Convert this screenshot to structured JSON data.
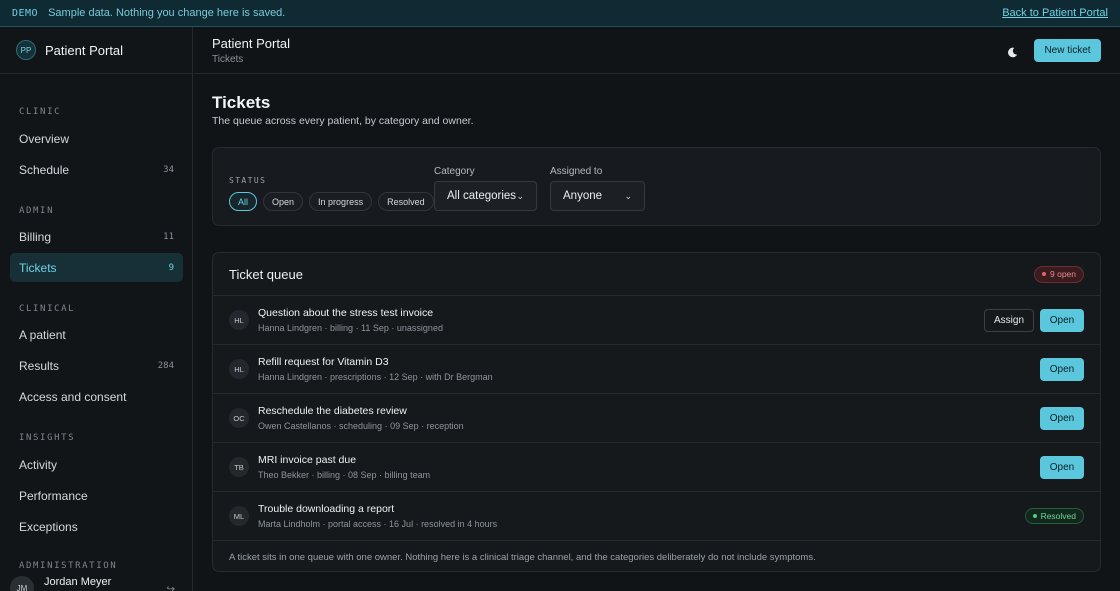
{
  "banner": {
    "tag": "DEMO",
    "message": "Sample data. Nothing you change here is saved.",
    "back_link": "Back to Patient Portal"
  },
  "brand": {
    "initials": "PP",
    "name": "Patient Portal"
  },
  "sidebar": {
    "sections": [
      {
        "label": "CLINIC",
        "items": [
          {
            "label": "Overview",
            "count": ""
          },
          {
            "label": "Schedule",
            "count": "34"
          }
        ]
      },
      {
        "label": "ADMIN",
        "items": [
          {
            "label": "Billing",
            "count": "11"
          },
          {
            "label": "Tickets",
            "count": "9",
            "active": true
          }
        ]
      },
      {
        "label": "CLINICAL",
        "items": [
          {
            "label": "A patient",
            "count": ""
          },
          {
            "label": "Results",
            "count": "284"
          },
          {
            "label": "Access and consent",
            "count": ""
          }
        ]
      },
      {
        "label": "INSIGHTS",
        "items": [
          {
            "label": "Activity",
            "count": ""
          },
          {
            "label": "Performance",
            "count": ""
          },
          {
            "label": "Exceptions",
            "count": ""
          }
        ]
      },
      {
        "label": "ADMINISTRATION",
        "items": []
      }
    ],
    "user": {
      "initials": "JM",
      "name": "Jordan Meyer"
    }
  },
  "header": {
    "title": "Patient Portal",
    "breadcrumb": "Tickets",
    "theme_icon": "moon-icon",
    "new_ticket_label": "New ticket"
  },
  "page": {
    "title": "Tickets",
    "subtitle": "The queue across every patient, by category and owner."
  },
  "filters": {
    "status_label": "STATUS",
    "status_options": [
      "All",
      "Open",
      "In progress",
      "Resolved"
    ],
    "status_selected": "All",
    "category_label": "Category",
    "category_value": "All categories",
    "assigned_label": "Assigned to",
    "assigned_value": "Anyone"
  },
  "queue": {
    "title": "Ticket queue",
    "open_badge": "9 open",
    "rows": [
      {
        "initials": "HL",
        "title": "Question about the stress test invoice",
        "meta": "Hanna Lindgren · billing · 11 Sep · unassigned",
        "assign": "Assign",
        "action": "Open",
        "status": ""
      },
      {
        "initials": "HL",
        "title": "Refill request for Vitamin D3",
        "meta": "Hanna Lindgren · prescriptions · 12 Sep · with Dr Bergman",
        "assign": "",
        "action": "Open",
        "status": ""
      },
      {
        "initials": "OC",
        "title": "Reschedule the diabetes review",
        "meta": "Owen Castellanos · scheduling · 09 Sep · reception",
        "assign": "",
        "action": "Open",
        "status": ""
      },
      {
        "initials": "TB",
        "title": "MRI invoice past due",
        "meta": "Theo Bekker · billing · 08 Sep · billing team",
        "assign": "",
        "action": "Open",
        "status": ""
      },
      {
        "initials": "ML",
        "title": "Trouble downloading a report",
        "meta": "Marta Lindholm · portal access · 16 Jul · resolved in 4 hours",
        "assign": "",
        "action": "",
        "status": "Resolved"
      }
    ],
    "footer": "A ticket sits in one queue with one owner. Nothing here is a clinical triage channel, and the categories deliberately do not include symptoms."
  },
  "colors": {
    "accent": "#5bc7dc",
    "open_badge": "#e88b90",
    "resolved_badge": "#6fd49a"
  }
}
